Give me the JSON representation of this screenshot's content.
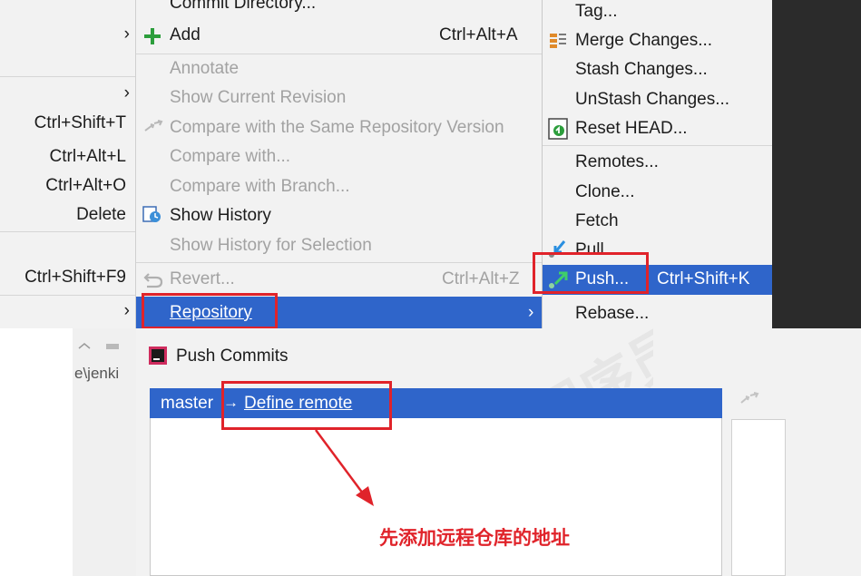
{
  "left_menu": {
    "items": [
      {
        "label": "",
        "arrow": "›"
      },
      {
        "label": "",
        "arrow": "›"
      },
      {
        "label": "Ctrl+Shift+T"
      },
      {
        "label": "Ctrl+Alt+L"
      },
      {
        "label": "Ctrl+Alt+O"
      },
      {
        "label": "Delete"
      },
      {
        "label": "Ctrl+Shift+F9"
      },
      {
        "label": "",
        "arrow": "›"
      }
    ]
  },
  "git_menu": {
    "items": [
      {
        "label": "Commit Directory...",
        "state": "enabled"
      },
      {
        "label": "Add",
        "shortcut": "Ctrl+Alt+A",
        "icon": "plus-icon",
        "arrow": "›",
        "state": "enabled"
      },
      {
        "label": "Annotate",
        "state": "disabled"
      },
      {
        "label": "Show Current Revision",
        "state": "disabled"
      },
      {
        "label": "Compare with the Same Repository Version",
        "icon": "compare-icon",
        "state": "disabled"
      },
      {
        "label": "Compare with...",
        "state": "disabled"
      },
      {
        "label": "Compare with Branch...",
        "state": "disabled"
      },
      {
        "label": "Show History",
        "icon": "history-icon",
        "state": "enabled"
      },
      {
        "label": "Show History for Selection",
        "state": "disabled"
      },
      {
        "label": "Revert...",
        "shortcut": "Ctrl+Alt+Z",
        "icon": "revert-icon",
        "state": "disabled"
      },
      {
        "label": "Repository",
        "arrow": "›",
        "state": "highlighted"
      }
    ]
  },
  "repository_menu": {
    "items": [
      {
        "label": "Tag..."
      },
      {
        "label": "Merge Changes...",
        "icon": "merge-icon"
      },
      {
        "label": "Stash Changes..."
      },
      {
        "label": "UnStash Changes..."
      },
      {
        "label": "Reset HEAD...",
        "icon": "reset-icon"
      },
      {
        "label": "Remotes..."
      },
      {
        "label": "Clone..."
      },
      {
        "label": "Fetch"
      },
      {
        "label": "Pull...",
        "icon": "pull-icon"
      },
      {
        "label": "Push...",
        "shortcut": "Ctrl+Shift+K",
        "icon": "push-icon",
        "state": "highlighted"
      },
      {
        "label": "Rebase..."
      }
    ]
  },
  "dialog": {
    "title": "Push Commits",
    "path_fragment": "e\\jenki",
    "branch": "master",
    "arrow": "→",
    "define_remote": "Define remote",
    "annotation": "先添加远程仓库的地址"
  },
  "colors": {
    "highlight": "#2f65ca",
    "annotation_red": "#e0232a",
    "disabled_text": "#a2a2a2"
  }
}
